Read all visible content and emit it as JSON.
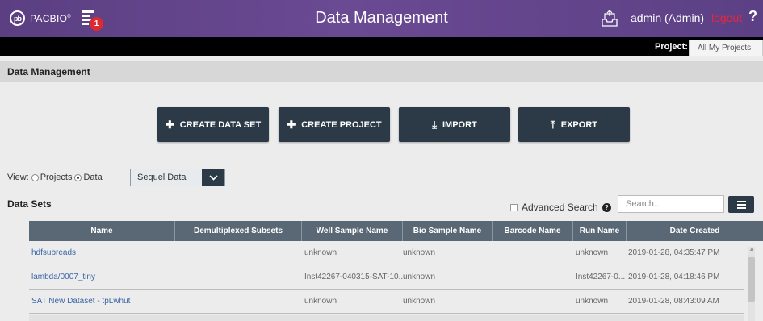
{
  "header": {
    "logo_mark": "pb",
    "logo_text": "PACBIO",
    "notification_count": "1",
    "app_title": "Data Management",
    "user": "admin (Admin)",
    "logout": "logout",
    "help": "?"
  },
  "project": {
    "label": "Project:",
    "selected": "All My Projects"
  },
  "page": {
    "title": "Data Management"
  },
  "actions": {
    "create_data_set": "CREATE DATA SET",
    "create_project": "CREATE PROJECT",
    "import": "IMPORT",
    "export": "EXPORT"
  },
  "view": {
    "label": "View:",
    "option_projects": "Projects",
    "option_data": "Data",
    "selected_option": "Data",
    "dataset_type": "Sequel Data"
  },
  "datasets": {
    "title": "Data Sets",
    "advanced_search": "Advanced Search",
    "search_placeholder": "Search...",
    "columns": [
      "Name",
      "Demultiplexed Subsets",
      "Well Sample Name",
      "Bio Sample Name",
      "Barcode Name",
      "Run Name",
      "Date Created"
    ],
    "rows": [
      {
        "name": "hdfsubreads",
        "demux": "",
        "well": "unknown",
        "bio": "unknown",
        "barcode": "",
        "run": "unknown",
        "date": "2019-01-28, 04:35:47 PM"
      },
      {
        "name": "lambda/0007_tiny",
        "demux": "",
        "well": "Inst42267-040315-SAT-10...",
        "bio": "unknown",
        "barcode": "",
        "run": "Inst42267-0...",
        "date": "2019-01-28, 04:18:46 PM"
      },
      {
        "name": "SAT New Dataset - tpLwhut",
        "demux": "",
        "well": "unknown",
        "bio": "unknown",
        "barcode": "",
        "run": "unknown",
        "date": "2019-01-28, 08:43:09 AM"
      }
    ]
  },
  "colors": {
    "header_purple": "#5b3f82",
    "button_dark": "#2c3a48",
    "table_header": "#5a6876",
    "link_blue": "#3b66a5",
    "logout_red": "#e8273a",
    "badge_red": "#e0282f"
  }
}
